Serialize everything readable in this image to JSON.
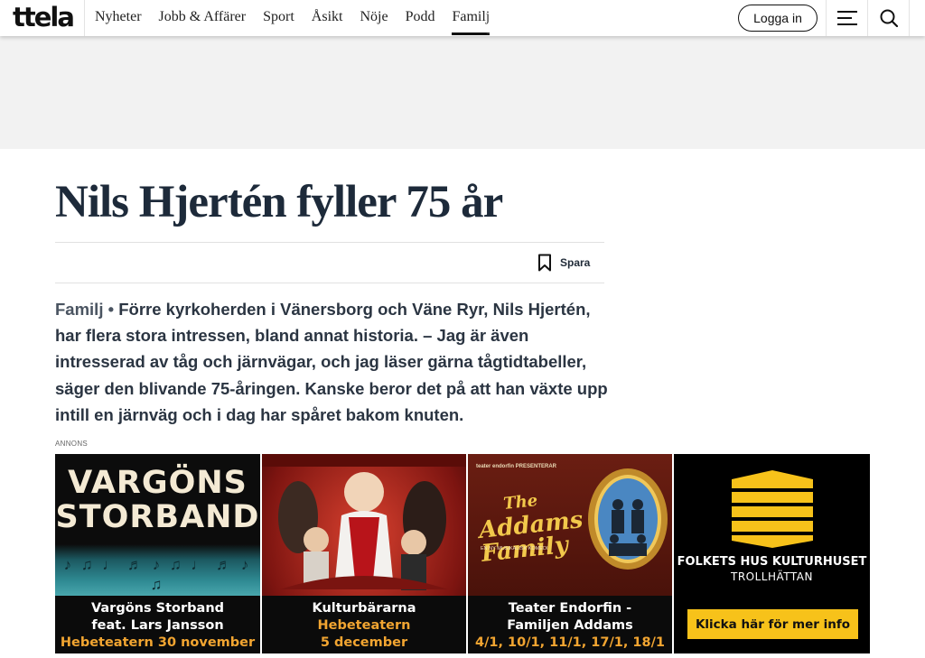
{
  "header": {
    "logo": "ttela",
    "nav": [
      "Nyheter",
      "Jobb & Affärer",
      "Sport",
      "Åsikt",
      "Nöje",
      "Podd",
      "Familj"
    ],
    "active_nav": "Familj",
    "login_label": "Logga in",
    "menu_icon": "hamburger-menu-icon",
    "search_icon": "search-icon"
  },
  "article": {
    "title": "Nils Hjertén fyller 75 år",
    "save_label": "Spara",
    "save_icon": "bookmark-icon",
    "category": "Familj",
    "bullet": "•",
    "lead": "Förre kyrkoherden i Vänersborg och Väne Ryr, Nils Hjertén, har flera stora intressen, bland annat historia. – Jag är även intresserad av tåg och järnvägar, och jag läser gärna tågtidtabeller, säger den blivande 75-åringen. Kanske beror det på att han växte upp intill en järnväg och i dag har spåret bakom knuten."
  },
  "ad": {
    "label": "ANNONS",
    "tiles": [
      {
        "headline_line1": "VARGÖNS",
        "headline_line2": "STORBAND",
        "caption_line1": "Vargöns Storband",
        "caption_line2": "feat. Lars Jansson",
        "caption_line3": "Hebeteatern 30 november"
      },
      {
        "caption_line1": "Kulturbärarna",
        "caption_line2": "Hebeteatern",
        "caption_line3": "5 december"
      },
      {
        "kicker": "teater endorfin PRESENTERAR",
        "script_line1": "The",
        "script_line2": "Addams",
        "script_line3": "Family",
        "subtitle": "EN NY MUSIKALISK KOMEDI",
        "caption_line1": "Teater Endorfin -",
        "caption_line2": "Familjen Addams",
        "caption_line3": "4/1, 10/1, 11/1, 17/1, 18/1"
      },
      {
        "name": "FOLKETS HUS KULTURHUSET",
        "city": "TROLLHÄTTAN",
        "cta": "Klicka här för mer info"
      }
    ]
  },
  "colors": {
    "title": "#1d2a3a",
    "ad_band": "#f2f2f2",
    "ad_gold": "#f2a531",
    "cta_yellow": "#f7c21a"
  }
}
